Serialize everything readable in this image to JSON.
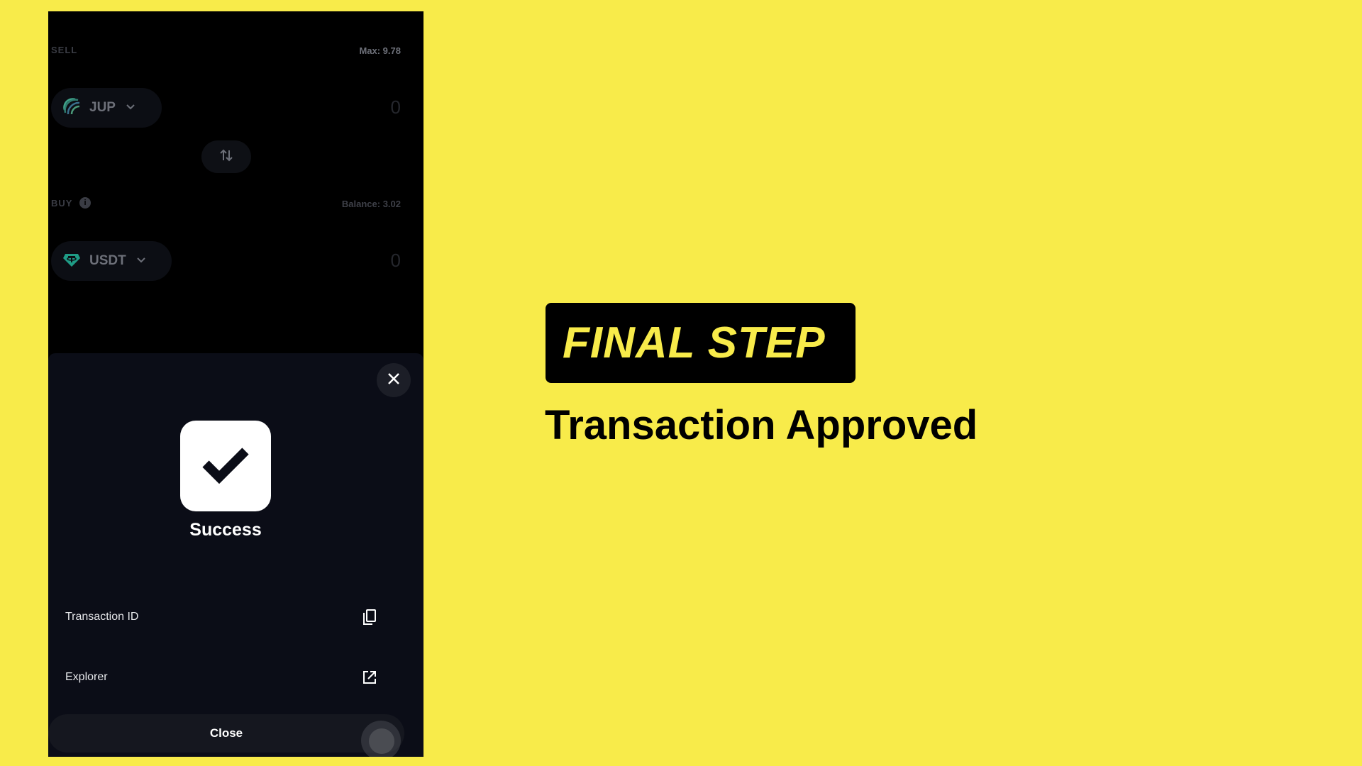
{
  "swap": {
    "sell_label": "SELL",
    "max_label": "Max: 9.78",
    "sell_token": "JUP",
    "sell_amount": "0",
    "buy_label": "BUY",
    "balance_label": "Balance: 3.02",
    "buy_token": "USDT",
    "buy_amount": "0"
  },
  "modal": {
    "status": "Success",
    "rows": [
      {
        "label": "Transaction ID",
        "icon": "copy-icon"
      },
      {
        "label": "Explorer",
        "icon": "external-link-icon"
      }
    ],
    "close_label": "Close"
  },
  "headline": {
    "badge": "FINAL STEP",
    "subtitle": "Transaction Approved"
  },
  "colors": {
    "background": "#F8EB4A",
    "sheet": "#0B0D17",
    "badge_bg": "#000000"
  }
}
